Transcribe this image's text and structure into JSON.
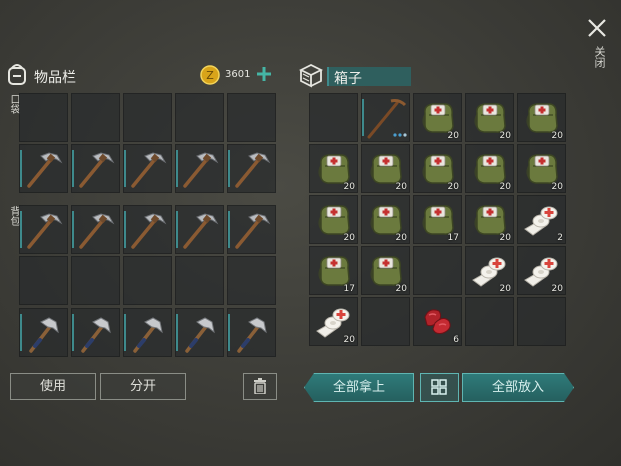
{
  "inventory": {
    "title": "物品栏",
    "coins": "3601",
    "pocket_label": "口袋",
    "backpack_label": "背包",
    "use_label": "使用",
    "split_label": "分开"
  },
  "box": {
    "title": "箱子",
    "take_all_label": "全部拿上",
    "put_all_label": "全部放入"
  },
  "close_label": "关闭",
  "colors": {
    "teal": "#2f7b7a",
    "accent": "#45b5a5"
  },
  "inventory_slots": [
    {
      "row": 0,
      "col": 0,
      "item": "empty"
    },
    {
      "row": 0,
      "col": 1,
      "item": "empty"
    },
    {
      "row": 0,
      "col": 2,
      "item": "empty"
    },
    {
      "row": 0,
      "col": 3,
      "item": "empty"
    },
    {
      "row": 0,
      "col": 4,
      "item": "empty"
    },
    {
      "row": 1,
      "col": 0,
      "item": "pickaxe"
    },
    {
      "row": 1,
      "col": 1,
      "item": "pickaxe"
    },
    {
      "row": 1,
      "col": 2,
      "item": "pickaxe"
    },
    {
      "row": 1,
      "col": 3,
      "item": "pickaxe"
    },
    {
      "row": 1,
      "col": 4,
      "item": "pickaxe"
    },
    {
      "row": 2,
      "col": 0,
      "item": "pickaxe"
    },
    {
      "row": 2,
      "col": 1,
      "item": "pickaxe"
    },
    {
      "row": 2,
      "col": 2,
      "item": "pickaxe"
    },
    {
      "row": 2,
      "col": 3,
      "item": "pickaxe"
    },
    {
      "row": 2,
      "col": 4,
      "item": "pickaxe"
    },
    {
      "row": 3,
      "col": 0,
      "item": "empty"
    },
    {
      "row": 3,
      "col": 1,
      "item": "empty"
    },
    {
      "row": 3,
      "col": 2,
      "item": "empty"
    },
    {
      "row": 3,
      "col": 3,
      "item": "empty"
    },
    {
      "row": 3,
      "col": 4,
      "item": "empty"
    },
    {
      "row": 4,
      "col": 0,
      "item": "hatchet"
    },
    {
      "row": 4,
      "col": 1,
      "item": "hatchet"
    },
    {
      "row": 4,
      "col": 2,
      "item": "hatchet"
    },
    {
      "row": 4,
      "col": 3,
      "item": "hatchet"
    },
    {
      "row": 4,
      "col": 4,
      "item": "hatchet"
    }
  ],
  "box_slots": [
    {
      "row": 0,
      "col": 0,
      "item": "empty",
      "count": ""
    },
    {
      "row": 0,
      "col": 1,
      "item": "pickaxe-wood",
      "count": ""
    },
    {
      "row": 0,
      "col": 2,
      "item": "medkit",
      "count": "20"
    },
    {
      "row": 0,
      "col": 3,
      "item": "medkit",
      "count": "20"
    },
    {
      "row": 0,
      "col": 4,
      "item": "medkit",
      "count": "20"
    },
    {
      "row": 1,
      "col": 0,
      "item": "medkit",
      "count": "20"
    },
    {
      "row": 1,
      "col": 1,
      "item": "medkit",
      "count": "20"
    },
    {
      "row": 1,
      "col": 2,
      "item": "medkit",
      "count": "20"
    },
    {
      "row": 1,
      "col": 3,
      "item": "medkit",
      "count": "20"
    },
    {
      "row": 1,
      "col": 4,
      "item": "medkit",
      "count": "20"
    },
    {
      "row": 2,
      "col": 0,
      "item": "medkit",
      "count": "20"
    },
    {
      "row": 2,
      "col": 1,
      "item": "medkit",
      "count": "20"
    },
    {
      "row": 2,
      "col": 2,
      "item": "medkit",
      "count": "17"
    },
    {
      "row": 2,
      "col": 3,
      "item": "medkit",
      "count": "20"
    },
    {
      "row": 2,
      "col": 4,
      "item": "bandage",
      "count": "2"
    },
    {
      "row": 3,
      "col": 0,
      "item": "medkit",
      "count": "17"
    },
    {
      "row": 3,
      "col": 1,
      "item": "medkit",
      "count": "20"
    },
    {
      "row": 3,
      "col": 2,
      "item": "empty",
      "count": ""
    },
    {
      "row": 3,
      "col": 3,
      "item": "bandage",
      "count": "20"
    },
    {
      "row": 3,
      "col": 4,
      "item": "bandage",
      "count": "20"
    },
    {
      "row": 4,
      "col": 0,
      "item": "bandage",
      "count": "20"
    },
    {
      "row": 4,
      "col": 1,
      "item": "empty",
      "count": ""
    },
    {
      "row": 4,
      "col": 2,
      "item": "meat",
      "count": "6"
    },
    {
      "row": 4,
      "col": 3,
      "item": "empty",
      "count": ""
    },
    {
      "row": 4,
      "col": 4,
      "item": "empty",
      "count": ""
    }
  ]
}
